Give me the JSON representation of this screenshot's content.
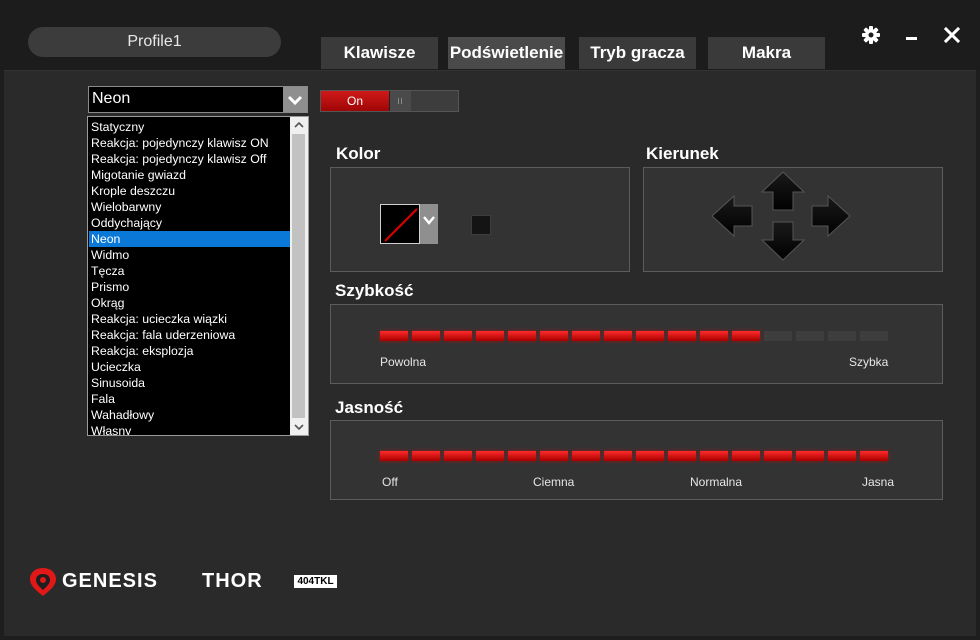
{
  "profile": {
    "name": "Profile1"
  },
  "tabs": [
    {
      "label": "Klawisze",
      "active": false
    },
    {
      "label": "Podświetlenie",
      "active": true
    },
    {
      "label": "Tryb gracza",
      "active": false
    },
    {
      "label": "Makra",
      "active": false
    }
  ],
  "window_controls": {
    "settings_icon": "gear-icon",
    "minimize_icon": "minimize-icon",
    "close_icon": "close-icon"
  },
  "effect": {
    "selected": "Neon",
    "options": [
      "Statyczny",
      "Reakcja: pojedynczy klawisz ON",
      "Reakcja: pojedynczy klawisz Off",
      "Migotanie gwiazd",
      "Krople deszczu",
      "Wielobarwny",
      "Oddychający",
      "Neon",
      "Widmo",
      "Tęcza",
      "Prismo",
      "Okrąg",
      "Reakcja: ucieczka wiązki",
      "Reakcja: fala uderzeniowa",
      "Reakcja: eksplozja",
      "Ucieczka",
      "Sinusoida",
      "Fala",
      "Wahadłowy",
      "Własny"
    ]
  },
  "power_toggle": {
    "label": "On",
    "state": true
  },
  "color": {
    "label": "Kolor",
    "swatch_icon": "no-color-icon"
  },
  "direction": {
    "label": "Kierunek",
    "icons": [
      "arrow-up-icon",
      "arrow-left-icon",
      "arrow-right-icon",
      "arrow-down-icon"
    ]
  },
  "speed": {
    "label": "Szybkość",
    "min_label": "Powolna",
    "max_label": "Szybka",
    "level": 12,
    "segments": 16
  },
  "brightness": {
    "label": "Jasność",
    "ticks": [
      "Off",
      "Ciemna",
      "Normalna",
      "Jasna"
    ],
    "level": 16,
    "segments": 16
  },
  "brand": {
    "name": "GENESIS",
    "product": "THOR",
    "badge": "404TKL"
  },
  "colors": {
    "accent": "#e00000",
    "selection": "#0a78d7",
    "background": "#2a2a2a"
  }
}
